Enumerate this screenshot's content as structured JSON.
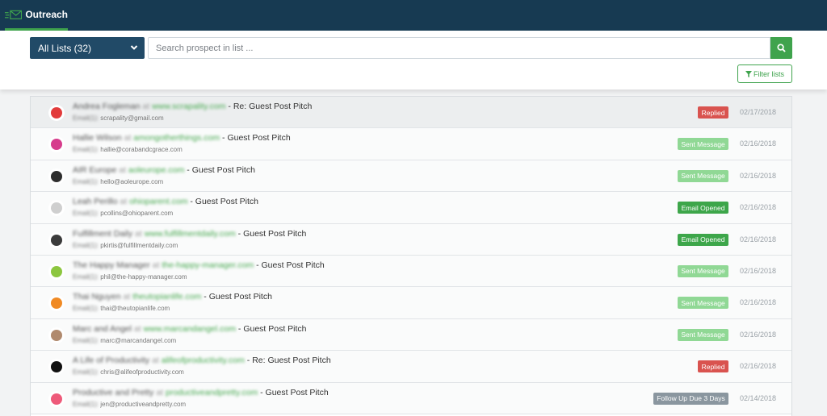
{
  "app": {
    "title": "Outreach",
    "logo_icon": "envelope-outreach-icon",
    "accent_color": "#3fa34d",
    "header_color": "#173a52"
  },
  "search": {
    "list_select_label": "All Lists (32)",
    "input_value": "",
    "placeholder": "Search prospect in list ...",
    "search_icon": "search-icon",
    "filter_label": "Filter lists",
    "filter_icon": "filter-icon"
  },
  "status_colors": {
    "Replied": "#d9534f",
    "Sent Message": "#90d895",
    "Email Opened": "#3da64a",
    "Follow Up Due 3 Days": "#8a969f"
  },
  "rows": [
    {
      "name": "Andrea Fogleman",
      "at": "at",
      "site": "www.scrapality.com",
      "subject": "Re: Guest Post Pitch",
      "email_prefix": "Email(1):",
      "email": "scrapality@gmail.com",
      "status": "Replied",
      "date": "02/17/2018",
      "avatar_color": "#e23b3b"
    },
    {
      "name": "Hallie Wilson",
      "at": "at",
      "site": "amongotherthings.com",
      "subject": "Guest Post Pitch",
      "email_prefix": "Email(1):",
      "email": "hallie@corabandcgrace.com",
      "status": "Sent Message",
      "date": "02/16/2018",
      "avatar_color": "#d63c8c"
    },
    {
      "name": "AIR Europe",
      "at": "at",
      "site": "aoleurope.com",
      "subject": "Guest Post Pitch",
      "email_prefix": "Email(1):",
      "email": "hello@aoleurope.com",
      "status": "Sent Message",
      "date": "02/16/2018",
      "avatar_color": "#2d2d2d"
    },
    {
      "name": "Leah Perillo",
      "at": "at",
      "site": "ohioparent.com",
      "subject": "Guest Post Pitch",
      "email_prefix": "Email(1):",
      "email": "pcollins@ohioparent.com",
      "status": "Email Opened",
      "date": "02/16/2018",
      "avatar_color": "#cfcfcf"
    },
    {
      "name": "Fulfillment Daily",
      "at": "at",
      "site": "www.fulfillmentdaily.com",
      "subject": "Guest Post Pitch",
      "email_prefix": "Email(1):",
      "email": "pkirtis@fulfillmentdaily.com",
      "status": "Email Opened",
      "date": "02/16/2018",
      "avatar_color": "#3b3b3b"
    },
    {
      "name": "The Happy Manager",
      "at": "at",
      "site": "the-happy-manager.com",
      "subject": "Guest Post Pitch",
      "email_prefix": "Email(1):",
      "email": "phil@the-happy-manager.com",
      "status": "Sent Message",
      "date": "02/16/2018",
      "avatar_color": "#8cc63f"
    },
    {
      "name": "Thai Nguyen",
      "at": "at",
      "site": "theutopianlife.com",
      "subject": "Guest Post Pitch",
      "email_prefix": "Email(1):",
      "email": "thai@theutopianlife.com",
      "status": "Sent Message",
      "date": "02/16/2018",
      "avatar_color": "#f08a24"
    },
    {
      "name": "Marc and Angel",
      "at": "at",
      "site": "www.marcandangel.com",
      "subject": "Guest Post Pitch",
      "email_prefix": "Email(1):",
      "email": "marc@marcandangel.com",
      "status": "Sent Message",
      "date": "02/16/2018",
      "avatar_color": "#b08a6e"
    },
    {
      "name": "A Life of Productivity",
      "at": "at",
      "site": "alifeofproductivity.com",
      "subject": "Re: Guest Post Pitch",
      "email_prefix": "Email(1):",
      "email": "chris@alifeofproductivity.com",
      "status": "Replied",
      "date": "02/16/2018",
      "avatar_color": "#111111"
    },
    {
      "name": "Productive and Pretty",
      "at": "at",
      "site": "productiveandpretty.com",
      "subject": "Guest Post Pitch",
      "email_prefix": "Email(1):",
      "email": "jen@productiveandpretty.com",
      "status": "Follow Up Due 3 Days",
      "date": "02/14/2018",
      "avatar_color": "#ee5a7a"
    }
  ]
}
